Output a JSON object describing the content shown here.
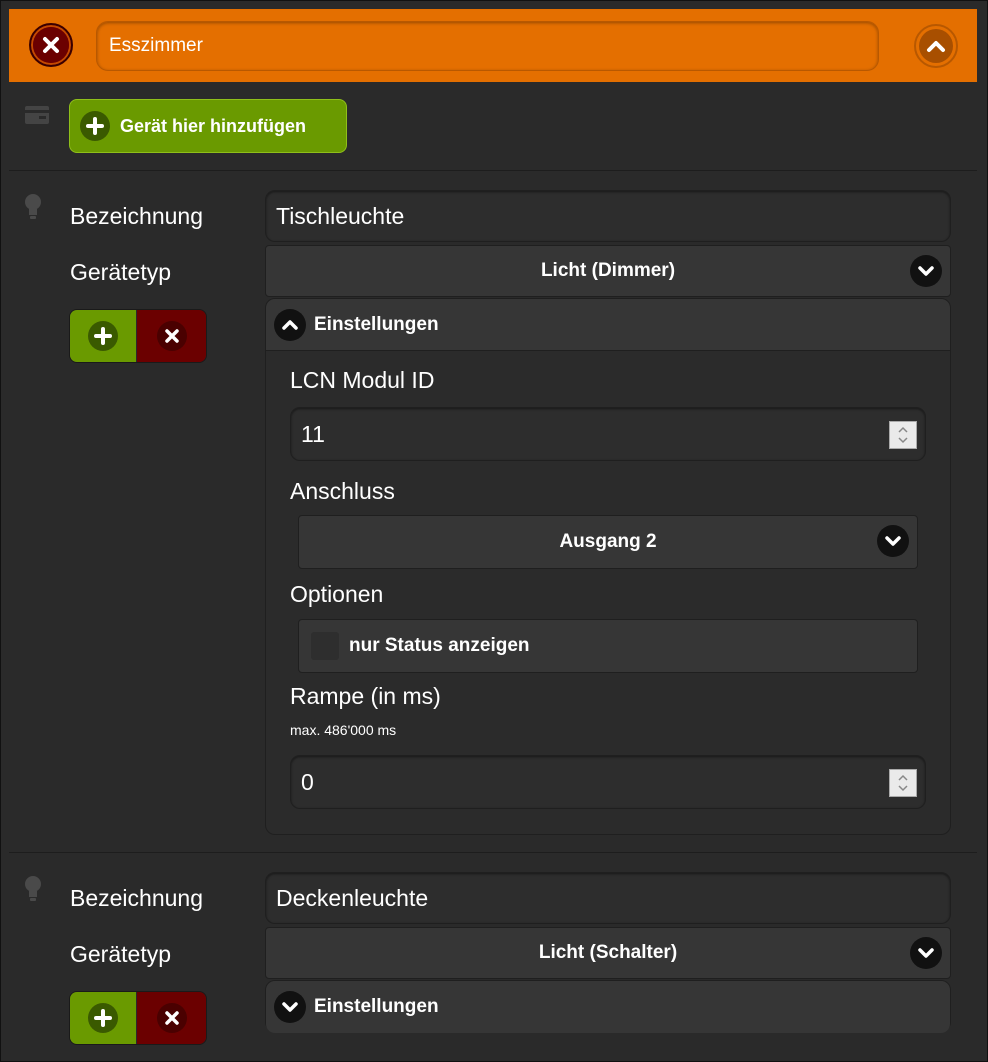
{
  "room": {
    "name": "Esszimmer",
    "colors": {
      "header": "#e46f00",
      "add": "#6a9a00",
      "remove": "#6b0000"
    }
  },
  "add_device": {
    "label": "Gerät hier hinzufügen"
  },
  "devices": [
    {
      "label_name": "Bezeichnung",
      "name": "Tischleuchte",
      "label_type": "Gerätetyp",
      "type": "Licht (Dimmer)",
      "settings": {
        "title": "Einstellungen",
        "expanded": true,
        "module_id_label": "LCN Modul ID",
        "module_id": "11",
        "connection_label": "Anschluss",
        "connection": "Ausgang 2",
        "options_label": "Optionen",
        "option_status_only": "nur Status anzeigen",
        "ramp_label": "Rampe (in ms)",
        "ramp_hint": "max. 486'000 ms",
        "ramp": "0"
      }
    },
    {
      "label_name": "Bezeichnung",
      "name": "Deckenleuchte",
      "label_type": "Gerätetyp",
      "type": "Licht (Schalter)",
      "settings": {
        "title": "Einstellungen",
        "expanded": false
      }
    }
  ]
}
